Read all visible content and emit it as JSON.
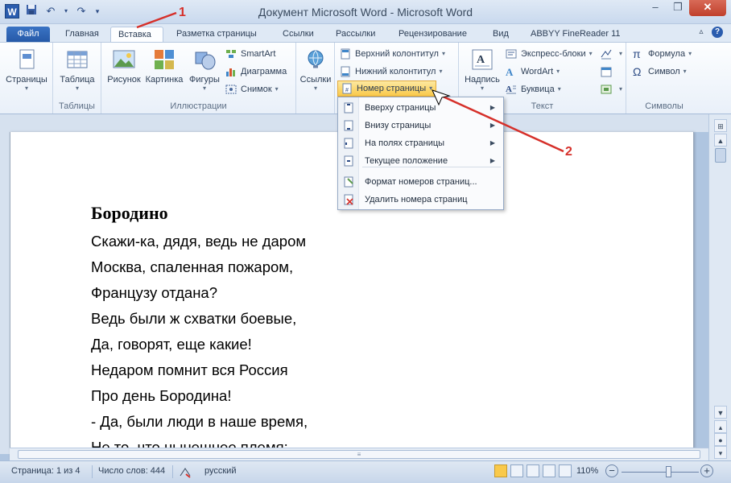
{
  "window": {
    "title": "Документ Microsoft Word  -  Microsoft Word",
    "minimize": "–",
    "restore": "❐",
    "close": "✕"
  },
  "tabs": [
    {
      "label": "Файл"
    },
    {
      "label": "Главная"
    },
    {
      "label": "Вставка"
    },
    {
      "label": "Разметка страницы"
    },
    {
      "label": "Ссылки"
    },
    {
      "label": "Рассылки"
    },
    {
      "label": "Рецензирование"
    },
    {
      "label": "Вид"
    },
    {
      "label": "ABBYY FineReader 11"
    }
  ],
  "ribbon": {
    "pages": {
      "label": "Страницы",
      "group": ""
    },
    "tables": {
      "table": "Таблица",
      "group": "Таблицы"
    },
    "illustrations": {
      "picture": "Рисунок",
      "clipart": "Картинка",
      "shapes": "Фигуры",
      "smartart": "SmartArt",
      "chart": "Диаграмма",
      "screenshot": "Снимок",
      "group": "Иллюстрации"
    },
    "links": {
      "label": "Ссылки"
    },
    "header_footer": {
      "header": "Верхний колонтитул",
      "footer": "Нижний колонтитул",
      "page_number": "Номер страницы"
    },
    "text": {
      "textbox": "Надпись",
      "quickparts": "Экспресс-блоки",
      "wordart": "WordArt",
      "dropcap": "Буквица",
      "group": "Текст"
    },
    "symbols": {
      "equation": "Формула",
      "symbol": "Символ",
      "group": "Символы"
    }
  },
  "page_number_menu": [
    {
      "label": "Вверху страницы",
      "submenu": true
    },
    {
      "label": "Внизу страницы",
      "submenu": true
    },
    {
      "label": "На полях страницы",
      "submenu": true
    },
    {
      "label": "Текущее положение",
      "submenu": true
    },
    {
      "label": "Формат номеров страниц...",
      "submenu": false
    },
    {
      "label": "Удалить номера страниц",
      "submenu": false
    }
  ],
  "document": {
    "title": "Бородино",
    "lines": [
      "Скажи-ка, дядя, ведь не даром",
      "Москва, спаленная пожаром,",
      "Французу отдана?",
      "Ведь были ж схватки боевые,",
      "Да, говорят, еще какие!",
      "Недаром помнит вся Россия",
      "Про день Бородина!",
      "- Да, были люди в наше время,",
      "Не то, что нынешнее племя:"
    ]
  },
  "status": {
    "page": "Страница: 1 из 4",
    "words": "Число слов: 444",
    "language": "русский",
    "zoom": "110%",
    "zoom_fraction": 0.6
  },
  "annotations": {
    "one": "1",
    "two": "2"
  },
  "colors": {
    "accent": "#2a5cae",
    "annotation": "#d6302a",
    "highlight": "#f9c94a"
  }
}
